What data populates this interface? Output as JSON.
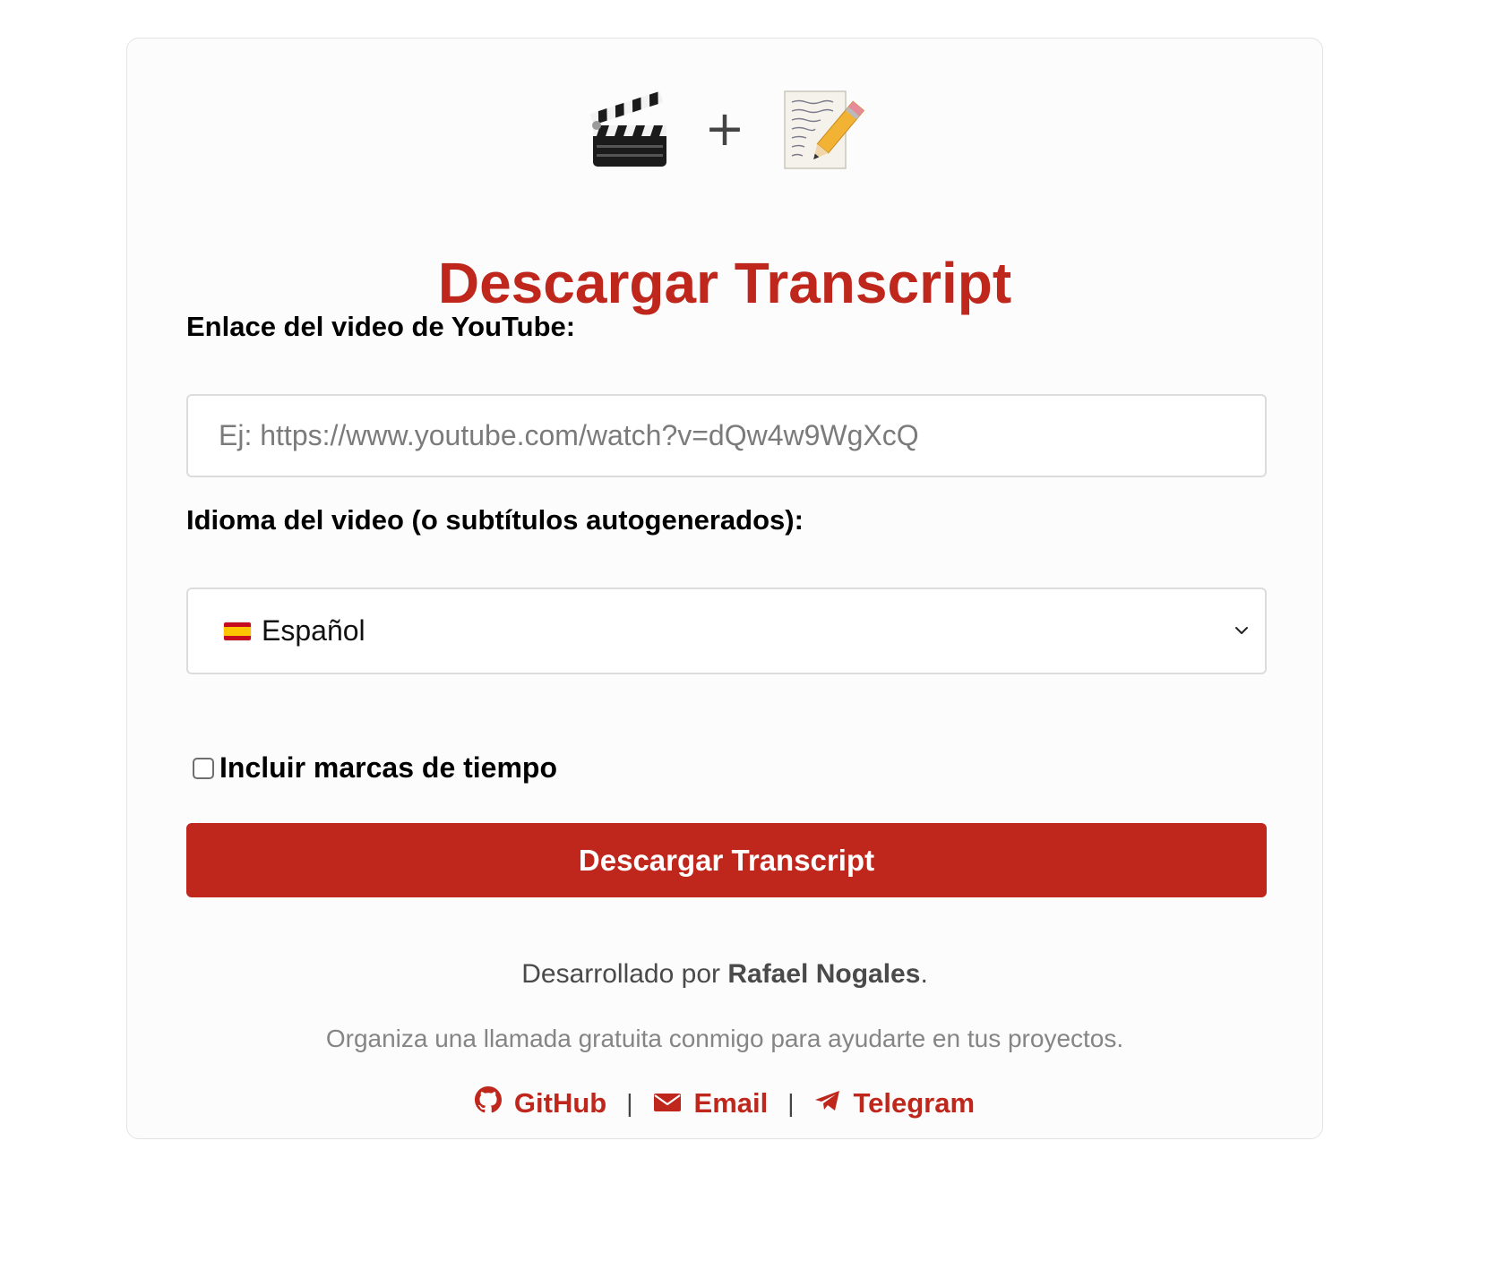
{
  "hero": {
    "left_icon": "clapper-board-icon",
    "joiner": "+",
    "right_icon": "memo-pencil-icon"
  },
  "title": "Descargar Transcript",
  "form": {
    "url_label": "Enlace del video de YouTube:",
    "url_placeholder": "Ej: https://www.youtube.com/watch?v=dQw4w9WgXcQ",
    "url_value": "",
    "language_label": "Idioma del video (o subtítulos autogenerados):",
    "language_selected": "Español",
    "language_flag": "spain-flag-icon",
    "timestamps_label": "Incluir marcas de tiempo",
    "timestamps_checked": false,
    "submit_label": "Descargar Transcript"
  },
  "footer": {
    "developed_by_prefix": "Desarrollado por ",
    "developer_name": "Rafael Nogales",
    "developed_by_suffix": ".",
    "cta": "Organiza una llamada gratuita conmigo para ayudarte en tus proyectos.",
    "links": [
      {
        "label": "GitHub",
        "icon": "github-icon"
      },
      {
        "label": "Email",
        "icon": "envelope-icon"
      },
      {
        "label": "Telegram",
        "icon": "telegram-icon"
      }
    ],
    "separator": "|"
  },
  "colors": {
    "accent": "#bf261c",
    "card_background": "#fcfcfc",
    "card_border": "#e3e3e3"
  }
}
